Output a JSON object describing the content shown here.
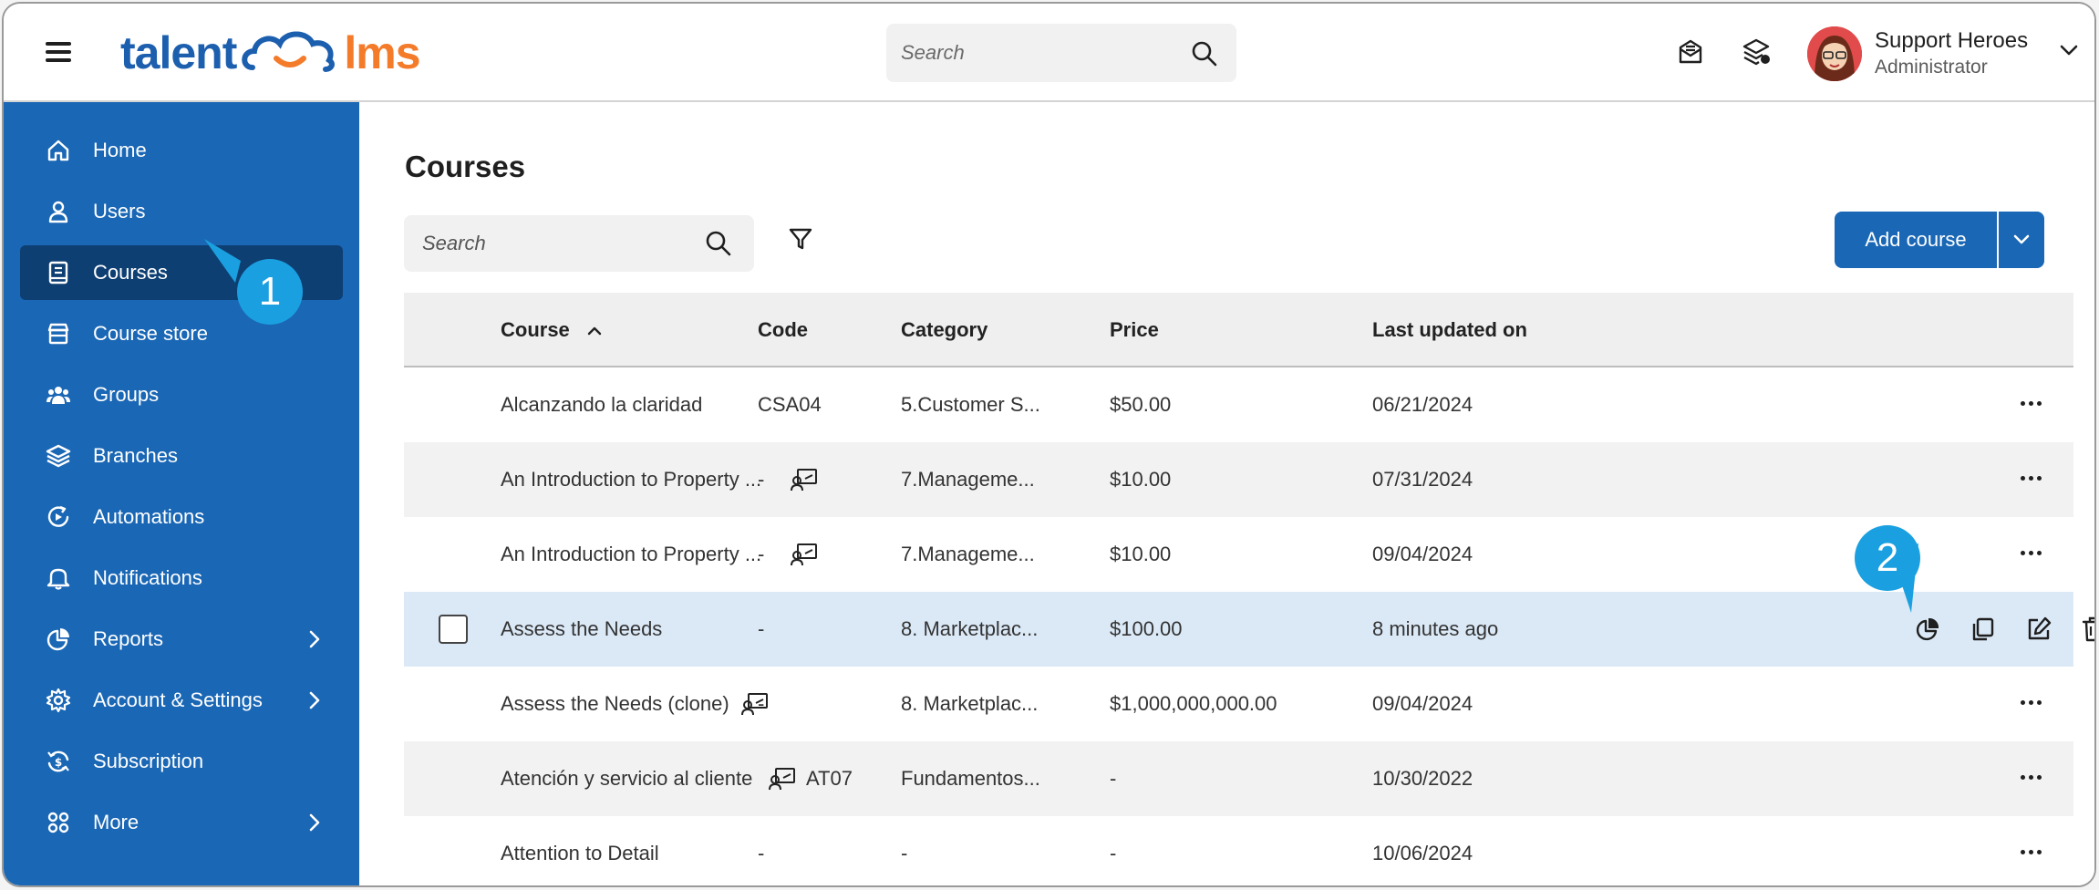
{
  "app": {
    "logo_left": "talent",
    "logo_right": "lms"
  },
  "top_search": {
    "placeholder": "Search"
  },
  "user": {
    "name": "Support Heroes",
    "role": "Administrator"
  },
  "sidebar": {
    "items": [
      {
        "label": "Home",
        "icon": "home-icon"
      },
      {
        "label": "Users",
        "icon": "user-icon"
      },
      {
        "label": "Courses",
        "icon": "book-icon",
        "active": true
      },
      {
        "label": "Course store",
        "icon": "store-icon"
      },
      {
        "label": "Groups",
        "icon": "groups-icon"
      },
      {
        "label": "Branches",
        "icon": "layers-icon"
      },
      {
        "label": "Automations",
        "icon": "automation-icon"
      },
      {
        "label": "Notifications",
        "icon": "bell-icon"
      },
      {
        "label": "Reports",
        "icon": "pie-chart-icon",
        "submenu": true
      },
      {
        "label": "Account & Settings",
        "icon": "gear-icon",
        "submenu": true
      },
      {
        "label": "Subscription",
        "icon": "subscription-icon"
      },
      {
        "label": "More",
        "icon": "grid-icon",
        "submenu": true
      }
    ]
  },
  "main": {
    "title": "Courses",
    "search_placeholder": "Search",
    "add_course_label": "Add course"
  },
  "table": {
    "columns": [
      "Course",
      "Code",
      "Category",
      "Price",
      "Last updated on"
    ],
    "rows": [
      {
        "course": "Alcanzando la claridad",
        "code": "CSA04",
        "category": "5.Customer S...",
        "price": "$50.00",
        "updated": "06/21/2024",
        "locked": false
      },
      {
        "course": "An Introduction to Property ...",
        "code": "-",
        "category": "7.Manageme...",
        "price": "$10.00",
        "updated": "07/31/2024",
        "locked": true
      },
      {
        "course": "An Introduction to Property ...",
        "code": "-",
        "category": "7.Manageme...",
        "price": "$10.00",
        "updated": "09/04/2024",
        "locked": true
      },
      {
        "course": "Assess the Needs",
        "code": "-",
        "category": "8. Marketplac...",
        "price": "$100.00",
        "updated": "8 minutes ago",
        "locked": false,
        "highlight": true
      },
      {
        "course": "Assess the Needs (clone)",
        "code": "-",
        "category": "8. Marketplac...",
        "price": "$1,000,000,000.00",
        "updated": "09/04/2024",
        "locked": true
      },
      {
        "course": "Atención y servicio al cliente",
        "code": "AT07",
        "category": "Fundamentos...",
        "price": "-",
        "updated": "10/30/2022",
        "locked": true
      },
      {
        "course": "Attention to Detail",
        "code": "-",
        "category": "-",
        "price": "-",
        "updated": "10/06/2024",
        "locked": false
      }
    ]
  },
  "callouts": {
    "first": "1",
    "second": "2"
  },
  "colors": {
    "sidebar": "#1a67b5",
    "sidebar_active": "#0e3f73",
    "accent": "#1a67b5",
    "logo_orange": "#f47b2a",
    "callout": "#1aa0e0",
    "row_highlight": "#dbe9f7"
  }
}
